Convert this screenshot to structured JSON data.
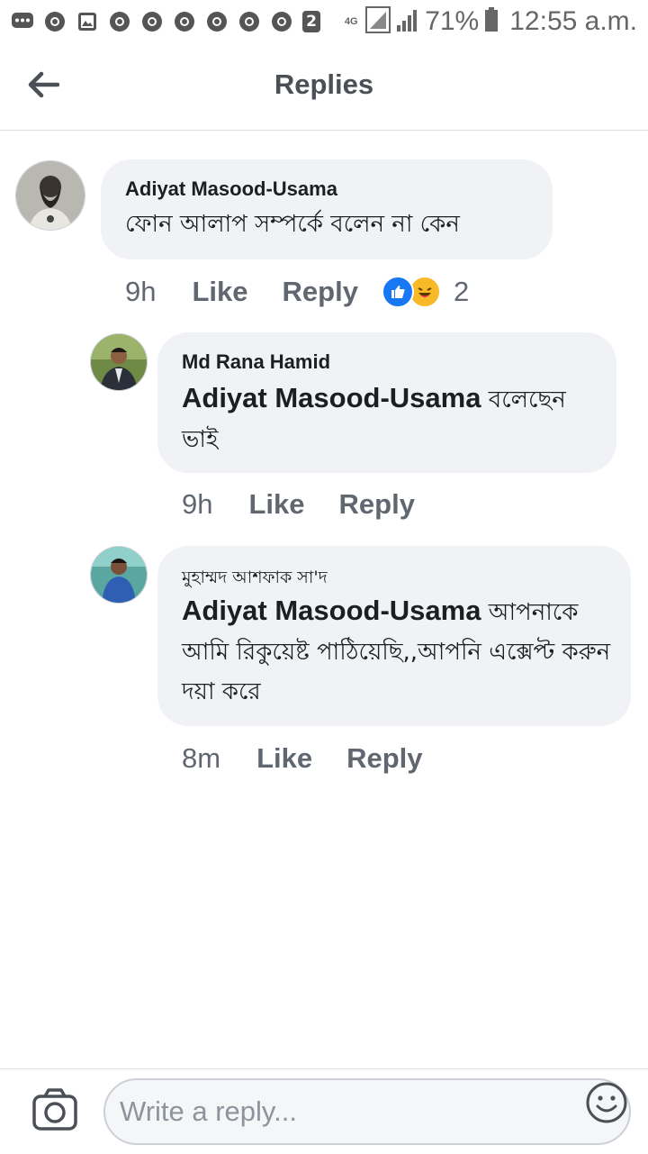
{
  "status_bar": {
    "notification_count": "2",
    "network": "4G",
    "battery": "71%",
    "time": "12:55 a.m."
  },
  "header": {
    "title": "Replies"
  },
  "comments": [
    {
      "author": "Adiyat Masood-Usama",
      "mention": "",
      "text": "ফোন আলাপ সম্পর্কে বলেন না কেন",
      "time": "9h",
      "like_label": "Like",
      "reply_label": "Reply",
      "reaction_count": "2",
      "reactions": [
        "like-icon",
        "laugh-icon"
      ]
    },
    {
      "author": "Md Rana Hamid",
      "mention": "Adiyat Masood-Usama",
      "text": " বলেছেন ভাই",
      "time": "9h",
      "like_label": "Like",
      "reply_label": "Reply"
    },
    {
      "author": "মুহাম্মদ আশফাক সা'দ",
      "mention": "Adiyat Masood-Usama",
      "text": " আপনাকে আমি রিকুয়েষ্ট পাঠিয়েছি,,আপনি এক্সেপ্ট করুন দয়া করে",
      "time": "8m",
      "like_label": "Like",
      "reply_label": "Reply"
    }
  ],
  "composer": {
    "placeholder": "Write a reply..."
  },
  "colors": {
    "bubble": "#f0f2f5",
    "meta_text": "#606770",
    "like_blue": "#1877f2",
    "laugh_yellow": "#f7b928"
  }
}
